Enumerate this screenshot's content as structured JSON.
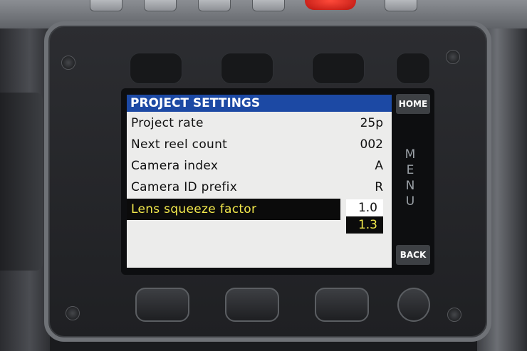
{
  "screen": {
    "title": "PROJECT SETTINGS",
    "rows": [
      {
        "label": "Project rate",
        "value": "25p"
      },
      {
        "label": "Next reel count",
        "value": "002"
      },
      {
        "label": "Camera index",
        "value": "A"
      },
      {
        "label": "Camera ID prefix",
        "value": "R"
      }
    ],
    "selected_row": {
      "label": "Lens squeeze factor",
      "current_value": "1.0",
      "option_value": "1.3"
    }
  },
  "softkeys": {
    "home_label": "HOME",
    "back_label": "BACK",
    "menu_letters": [
      "M",
      "E",
      "N",
      "U"
    ]
  },
  "colors": {
    "title_bar": "#1c49a4",
    "selected_text": "#f3e94c",
    "record_button": "#e0261c"
  }
}
